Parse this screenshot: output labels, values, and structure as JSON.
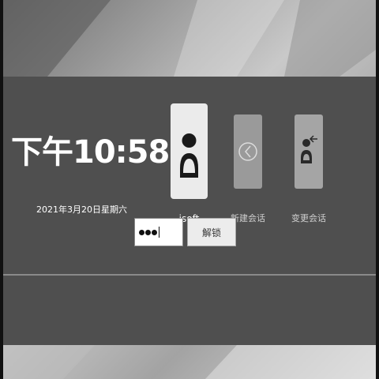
{
  "clock": {
    "time": "下午10:58",
    "date": "2021年3月20日星期六"
  },
  "sessions": [
    {
      "label": "isoft",
      "icon": "user-icon"
    },
    {
      "label": "新建会话",
      "icon": "back-arrow-icon"
    },
    {
      "label": "变更会话",
      "icon": "switch-user-icon"
    }
  ],
  "password": {
    "masked_length": 3
  },
  "unlock_button": {
    "label": "解锁"
  },
  "colors": {
    "panel": "#4f4f4f",
    "tile_active": "#ebebeb",
    "tile_inactive": "#9a9a9a"
  }
}
